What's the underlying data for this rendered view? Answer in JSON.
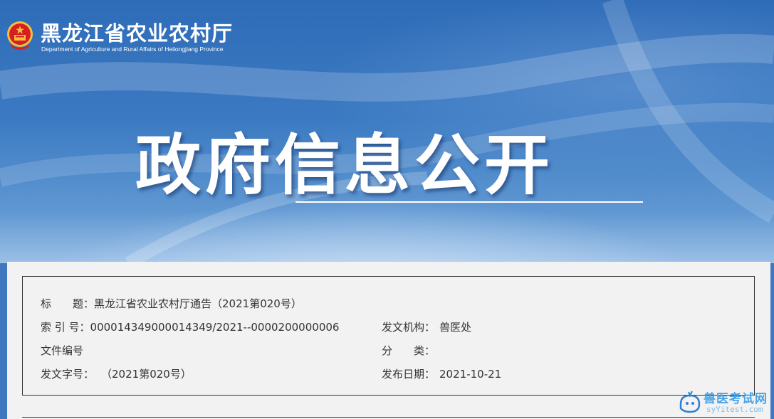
{
  "header": {
    "org_name_cn": "黑龙江省农业农村厅",
    "org_name_en": "Department of Agriculture and Rural Affairs of Heilongjiang Province",
    "emblem_icon": "national-emblem-icon"
  },
  "hero": {
    "title": "政府信息公开"
  },
  "info": {
    "title_label": "标　　题：",
    "title_value": "黑龙江省农业农村厅通告（2021第020号）",
    "index_label": "索 引 号：",
    "index_value": "000014349000014349/2021--0000200000006",
    "issuer_label": "发文机构：",
    "issuer_value": "兽医处",
    "doc_no_label": "文件编号",
    "doc_no_value": "",
    "category_label": "分　　类：",
    "category_value": "",
    "ref_label": "发文字号：",
    "ref_value": "（2021第020号）",
    "date_label": "发布日期：",
    "date_value": "2021-10-21"
  },
  "watermark": {
    "text": "兽医考试网",
    "sub": "syYitest.com",
    "icon": "bird-logo-icon"
  },
  "colors": {
    "banner_blue": "#2f6cb8",
    "content_bg": "#f2f2f2",
    "text": "#333333",
    "watermark_blue": "#4aa3e6"
  }
}
